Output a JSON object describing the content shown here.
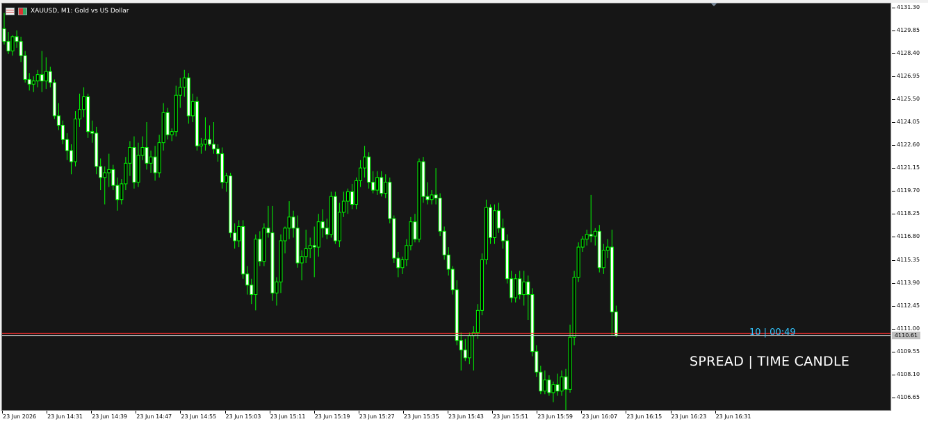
{
  "window": {
    "title": "XAUUSD, M1:  Gold vs US Dollar",
    "icons": [
      "market-watch-icon",
      "one-click-trading-icon"
    ]
  },
  "indicator": {
    "label": "SPREAD | TIME CANDLE",
    "spread_timer": "10 | 00:49",
    "timer_color": "#33c6ff",
    "label_color": "#ffffff"
  },
  "colors": {
    "background": "#161616",
    "candle": "#00ff00",
    "bid_line": "#c0c0c0",
    "ask_line": "#ff3030"
  },
  "price_axis": {
    "labels": [
      "4131.30",
      "4129.85",
      "4128.40",
      "4126.95",
      "4125.50",
      "4124.05",
      "4122.60",
      "4121.15",
      "4119.70",
      "4118.25",
      "4116.80",
      "4115.35",
      "4113.90",
      "4112.45",
      "4111.00",
      "4109.55",
      "4108.10",
      "4106.65"
    ],
    "current_price": "4110.61"
  },
  "time_axis": {
    "labels": [
      "23 Jun 2026",
      "23 Jun 14:31",
      "23 Jun 14:39",
      "23 Jun 14:47",
      "23 Jun 14:55",
      "23 Jun 15:03",
      "23 Jun 15:11",
      "23 Jun 15:19",
      "23 Jun 15:27",
      "23 Jun 15:35",
      "23 Jun 15:43",
      "23 Jun 15:51",
      "23 Jun 15:59",
      "23 Jun 16:07",
      "23 Jun 16:15",
      "23 Jun 16:23",
      "23 Jun 16:31"
    ]
  },
  "chart_data": {
    "type": "candlestick",
    "symbol": "XAUUSD",
    "timeframe": "M1",
    "ylim": [
      4105.9,
      4131.6
    ],
    "bid": 4110.61,
    "ask": 4110.75,
    "ohlc": [
      [
        4130.0,
        4131.0,
        4129.0,
        4129.2
      ],
      [
        4129.2,
        4129.8,
        4128.4,
        4128.6
      ],
      [
        4128.6,
        4129.6,
        4128.3,
        4129.5
      ],
      [
        4129.5,
        4129.9,
        4128.8,
        4129.2
      ],
      [
        4129.2,
        4129.5,
        4127.9,
        4128.3
      ],
      [
        4128.3,
        4128.6,
        4126.6,
        4126.8
      ],
      [
        4126.8,
        4127.2,
        4126.1,
        4126.5
      ],
      [
        4126.5,
        4127.0,
        4126.0,
        4126.7
      ],
      [
        4126.7,
        4127.4,
        4126.3,
        4127.1
      ],
      [
        4127.1,
        4128.6,
        4126.0,
        4126.7
      ],
      [
        4126.7,
        4128.2,
        4126.2,
        4127.3
      ],
      [
        4127.3,
        4127.6,
        4126.3,
        4126.6
      ],
      [
        4126.6,
        4126.8,
        4124.3,
        4124.5
      ],
      [
        4124.5,
        4125.3,
        4123.6,
        4123.9
      ],
      [
        4123.9,
        4124.2,
        4122.7,
        4123.0
      ],
      [
        4123.0,
        4123.4,
        4121.7,
        4122.3
      ],
      [
        4122.3,
        4122.7,
        4120.8,
        4121.6
      ],
      [
        4121.6,
        4124.8,
        4121.3,
        4124.3
      ],
      [
        4124.3,
        4125.9,
        4123.8,
        4124.9
      ],
      [
        4124.9,
        4126.3,
        4124.4,
        4125.7
      ],
      [
        4125.7,
        4125.9,
        4123.1,
        4123.5
      ],
      [
        4123.5,
        4124.2,
        4122.8,
        4123.4
      ],
      [
        4123.4,
        4123.8,
        4120.8,
        4121.3
      ],
      [
        4121.3,
        4121.8,
        4119.8,
        4120.6
      ],
      [
        4120.6,
        4121.3,
        4118.9,
        4120.9
      ],
      [
        4120.9,
        4122.1,
        4120.0,
        4121.1
      ],
      [
        4121.1,
        4121.4,
        4119.8,
        4120.1
      ],
      [
        4120.1,
        4120.6,
        4118.5,
        4119.2
      ],
      [
        4119.2,
        4120.5,
        4118.9,
        4120.2
      ],
      [
        4120.2,
        4121.9,
        4119.8,
        4121.5
      ],
      [
        4121.5,
        4122.9,
        4120.7,
        4122.5
      ],
      [
        4122.5,
        4123.2,
        4119.9,
        4120.3
      ],
      [
        4120.3,
        4122.8,
        4120.0,
        4122.0
      ],
      [
        4122.0,
        4123.2,
        4121.7,
        4122.5
      ],
      [
        4122.5,
        4124.1,
        4121.1,
        4121.5
      ],
      [
        4121.5,
        4122.3,
        4120.9,
        4121.9
      ],
      [
        4121.9,
        4122.6,
        4120.4,
        4120.9
      ],
      [
        4120.9,
        4123.3,
        4120.6,
        4122.8
      ],
      [
        4122.8,
        4125.3,
        4122.3,
        4124.7
      ],
      [
        4124.7,
        4125.0,
        4123.0,
        4123.3
      ],
      [
        4123.3,
        4123.7,
        4122.9,
        4123.5
      ],
      [
        4123.5,
        4126.4,
        4123.2,
        4125.8
      ],
      [
        4125.8,
        4126.9,
        4125.0,
        4126.3
      ],
      [
        4126.3,
        4127.4,
        4125.7,
        4126.9
      ],
      [
        4126.9,
        4127.2,
        4124.0,
        4124.5
      ],
      [
        4124.5,
        4125.9,
        4124.1,
        4125.4
      ],
      [
        4125.4,
        4125.7,
        4122.3,
        4122.6
      ],
      [
        4122.6,
        4123.1,
        4122.1,
        4122.7
      ],
      [
        4122.7,
        4124.4,
        4122.3,
        4123.0
      ],
      [
        4123.0,
        4123.9,
        4122.6,
        4122.7
      ],
      [
        4122.7,
        4124.1,
        4122.1,
        4122.4
      ],
      [
        4122.4,
        4122.7,
        4121.6,
        4122.1
      ],
      [
        4122.1,
        4122.5,
        4119.9,
        4120.3
      ],
      [
        4120.3,
        4120.9,
        4119.7,
        4120.7
      ],
      [
        4120.7,
        4120.9,
        4116.8,
        4117.1
      ],
      [
        4117.1,
        4117.7,
        4116.1,
        4116.6
      ],
      [
        4116.6,
        4117.9,
        4116.2,
        4117.5
      ],
      [
        4117.5,
        4117.9,
        4114.2,
        4114.5
      ],
      [
        4114.5,
        4115.0,
        4113.2,
        4113.8
      ],
      [
        4113.8,
        4114.2,
        4112.6,
        4113.2
      ],
      [
        4113.2,
        4117.0,
        4112.2,
        4116.7
      ],
      [
        4116.7,
        4117.2,
        4115.0,
        4115.3
      ],
      [
        4115.3,
        4117.7,
        4115.0,
        4117.4
      ],
      [
        4117.4,
        4118.8,
        4116.8,
        4117.1
      ],
      [
        4117.1,
        4118.8,
        4112.8,
        4113.3
      ],
      [
        4113.3,
        4114.3,
        4112.5,
        4114.0
      ],
      [
        4114.0,
        4117.0,
        4113.3,
        4116.6
      ],
      [
        4116.6,
        4117.5,
        4115.8,
        4117.4
      ],
      [
        4117.4,
        4119.1,
        4116.7,
        4118.1
      ],
      [
        4118.1,
        4118.5,
        4116.8,
        4117.4
      ],
      [
        4117.4,
        4118.2,
        4114.9,
        4115.2
      ],
      [
        4115.2,
        4116.0,
        4114.1,
        4115.6
      ],
      [
        4115.6,
        4117.3,
        4115.2,
        4116.1
      ],
      [
        4116.1,
        4116.8,
        4115.5,
        4116.3
      ],
      [
        4116.3,
        4117.5,
        4114.3,
        4116.2
      ],
      [
        4116.2,
        4118.3,
        4115.6,
        4117.8
      ],
      [
        4117.8,
        4118.6,
        4116.8,
        4117.4
      ],
      [
        4117.4,
        4118.0,
        4116.7,
        4117.0
      ],
      [
        4117.0,
        4119.7,
        4116.8,
        4119.4
      ],
      [
        4119.4,
        4119.7,
        4116.4,
        4116.6
      ],
      [
        4116.6,
        4119.0,
        4116.2,
        4118.4
      ],
      [
        4118.4,
        4119.7,
        4118.1,
        4119.1
      ],
      [
        4119.1,
        4119.9,
        4118.3,
        4119.7
      ],
      [
        4119.7,
        4120.2,
        4118.6,
        4118.9
      ],
      [
        4118.9,
        4120.6,
        4118.6,
        4120.4
      ],
      [
        4120.4,
        4121.7,
        4120.0,
        4121.2
      ],
      [
        4121.2,
        4122.6,
        4120.6,
        4121.9
      ],
      [
        4121.9,
        4122.2,
        4119.9,
        4120.3
      ],
      [
        4120.3,
        4121.0,
        4119.6,
        4119.8
      ],
      [
        4119.8,
        4121.0,
        4119.5,
        4120.6
      ],
      [
        4120.6,
        4121.0,
        4119.4,
        4119.6
      ],
      [
        4119.6,
        4120.8,
        4119.3,
        4120.3
      ],
      [
        4120.3,
        4120.6,
        4117.7,
        4118.0
      ],
      [
        4118.0,
        4118.2,
        4115.2,
        4115.5
      ],
      [
        4115.5,
        4115.9,
        4114.3,
        4114.9
      ],
      [
        4114.9,
        4115.6,
        4114.5,
        4115.4
      ],
      [
        4115.4,
        4116.7,
        4115.0,
        4116.3
      ],
      [
        4116.3,
        4118.1,
        4116.0,
        4117.8
      ],
      [
        4117.8,
        4118.3,
        4116.5,
        4116.7
      ],
      [
        4116.7,
        4121.8,
        4116.5,
        4121.6
      ],
      [
        4121.6,
        4121.9,
        4119.0,
        4119.4
      ],
      [
        4119.4,
        4120.3,
        4118.9,
        4119.2
      ],
      [
        4119.2,
        4119.8,
        4118.9,
        4119.5
      ],
      [
        4119.5,
        4121.2,
        4118.9,
        4119.3
      ],
      [
        4119.3,
        4119.6,
        4116.9,
        4117.2
      ],
      [
        4117.2,
        4117.5,
        4115.4,
        4115.7
      ],
      [
        4115.7,
        4116.2,
        4114.4,
        4114.8
      ],
      [
        4114.8,
        4115.0,
        4113.2,
        4113.5
      ],
      [
        4113.5,
        4114.1,
        4110.0,
        4110.3
      ],
      [
        4110.3,
        4110.8,
        4108.4,
        4109.7
      ],
      [
        4109.7,
        4110.4,
        4109.0,
        4109.2
      ],
      [
        4109.2,
        4110.8,
        4108.8,
        4110.6
      ],
      [
        4110.6,
        4111.2,
        4108.4,
        4110.8
      ],
      [
        4110.8,
        4112.6,
        4110.4,
        4112.2
      ],
      [
        4112.2,
        4115.8,
        4111.9,
        4115.4
      ],
      [
        4115.4,
        4119.2,
        4115.1,
        4118.7
      ],
      [
        4118.7,
        4118.9,
        4116.4,
        4116.8
      ],
      [
        4116.8,
        4118.9,
        4116.4,
        4118.5
      ],
      [
        4118.5,
        4119.0,
        4117.1,
        4117.4
      ],
      [
        4117.4,
        4118.0,
        4116.1,
        4116.6
      ],
      [
        4116.6,
        4117.0,
        4113.9,
        4114.2
      ],
      [
        4114.2,
        4114.7,
        4112.7,
        4113.0
      ],
      [
        4113.0,
        4114.5,
        4112.7,
        4114.2
      ],
      [
        4114.2,
        4114.7,
        4112.9,
        4113.2
      ],
      [
        4113.2,
        4114.7,
        4112.5,
        4114.0
      ],
      [
        4114.0,
        4114.4,
        4111.6,
        4113.2
      ],
      [
        4113.2,
        4113.6,
        4109.3,
        4109.6
      ],
      [
        4109.6,
        4110.0,
        4108.0,
        4108.3
      ],
      [
        4108.3,
        4108.7,
        4106.9,
        4107.1
      ],
      [
        4107.1,
        4108.4,
        4106.9,
        4107.8
      ],
      [
        4107.8,
        4108.1,
        4106.8,
        4107.0
      ],
      [
        4107.0,
        4107.7,
        4106.4,
        4107.5
      ],
      [
        4107.5,
        4108.2,
        4106.8,
        4107.1
      ],
      [
        4107.1,
        4108.4,
        4106.8,
        4108.0
      ],
      [
        4108.0,
        4108.5,
        4105.9,
        4107.2
      ],
      [
        4107.2,
        4111.3,
        4107.0,
        4110.5
      ],
      [
        4110.5,
        4114.7,
        4110.0,
        4114.3
      ],
      [
        4114.3,
        4116.5,
        4114.0,
        4116.2
      ],
      [
        4116.2,
        4116.9,
        4115.9,
        4116.7
      ],
      [
        4116.7,
        4117.3,
        4116.3,
        4117.0
      ],
      [
        4117.0,
        4119.5,
        4116.5,
        4116.9
      ],
      [
        4116.9,
        4117.4,
        4116.3,
        4117.2
      ],
      [
        4117.2,
        4117.6,
        4114.6,
        4114.9
      ],
      [
        4114.9,
        4116.4,
        4114.5,
        4116.0
      ],
      [
        4116.0,
        4116.7,
        4115.5,
        4116.2
      ],
      [
        4116.2,
        4117.3,
        4110.6,
        4112.1
      ],
      [
        4112.1,
        4112.5,
        4110.5,
        4110.61
      ]
    ]
  }
}
